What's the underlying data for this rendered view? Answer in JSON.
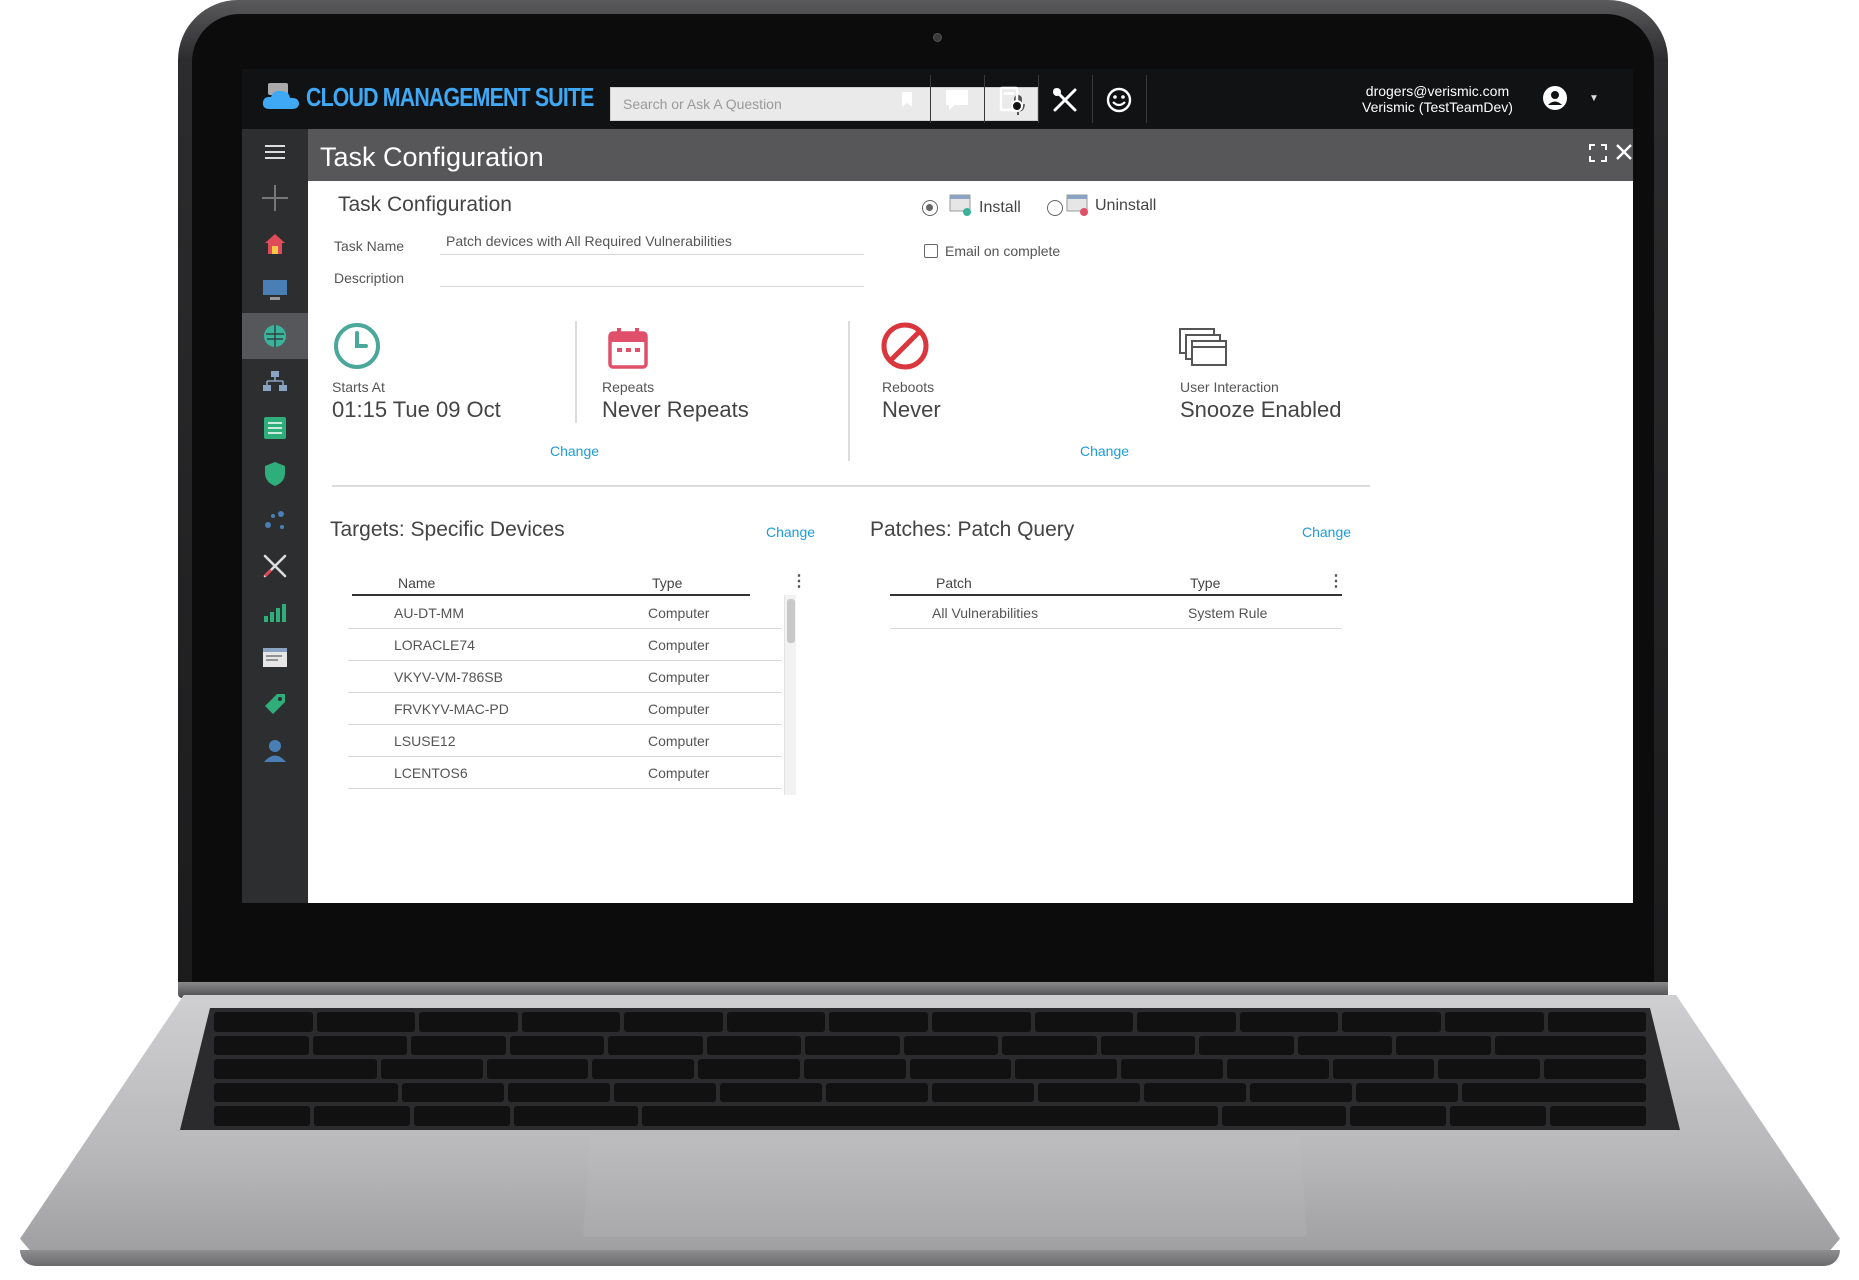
{
  "app": {
    "brand": "CLOUD MANAGEMENT SUITE",
    "search_placeholder": "Search or Ask A Question",
    "user_email": "drogers@verismic.com",
    "user_org": "Verismic (TestTeamDev)",
    "page_title": "Task Configuration"
  },
  "form": {
    "title": "Task Configuration",
    "task_name_label": "Task Name",
    "task_name_value": "Patch devices with All Required Vulnerabilities",
    "description_label": "Description",
    "description_value": "",
    "install_label": "Install",
    "uninstall_label": "Uninstall",
    "email_label": "Email on complete",
    "install_selected": true,
    "email_checked": false
  },
  "schedule": {
    "starts_label": "Starts At",
    "starts_value": "01:15 Tue 09 Oct",
    "repeats_label": "Repeats",
    "repeats_value": "Never Repeats",
    "reboots_label": "Reboots",
    "reboots_value": "Never",
    "interaction_label": "User Interaction",
    "interaction_value": "Snooze Enabled",
    "change_label": "Change"
  },
  "targets": {
    "title": "Targets: Specific Devices",
    "change_label": "Change",
    "columns": [
      "Name",
      "Type"
    ],
    "rows": [
      {
        "name": "AU-DT-MM",
        "type": "Computer"
      },
      {
        "name": "LORACLE74",
        "type": "Computer"
      },
      {
        "name": "VKYV-VM-786SB",
        "type": "Computer"
      },
      {
        "name": "FRVKYV-MAC-PD",
        "type": "Computer"
      },
      {
        "name": "LSUSE12",
        "type": "Computer"
      },
      {
        "name": "LCENTOS6",
        "type": "Computer"
      }
    ]
  },
  "patches": {
    "title": "Patches: Patch Query",
    "change_label": "Change",
    "columns": [
      "Patch",
      "Type"
    ],
    "rows": [
      {
        "patch": "All Vulnerabilities",
        "type": "System Rule"
      }
    ]
  },
  "colors": {
    "accent": "#1e9bd7",
    "brand": "#3fa9f5",
    "clock": "#4aa89a",
    "calendar": "#e0506a",
    "no_reboot": "#d9363e"
  }
}
